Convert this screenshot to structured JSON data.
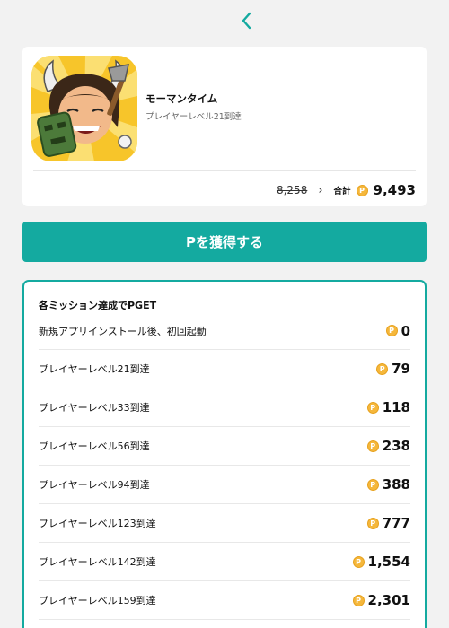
{
  "header": {
    "back_icon": "chevron-left-icon",
    "accent": "#14aaa0"
  },
  "app": {
    "name": "モーマンタイム",
    "subtitle": "プレイヤーレベル21到達",
    "old_points": "8,258",
    "total_label": "合計",
    "total_points": "9,493",
    "coin_symbol": "P"
  },
  "cta": {
    "label": "Pを獲得する"
  },
  "missions": {
    "title": "各ミッション達成でPGET",
    "items": [
      {
        "label": "新規アプリインストール後、初回起動",
        "reward": "0"
      },
      {
        "label": "プレイヤーレベル21到達",
        "reward": "79"
      },
      {
        "label": "プレイヤーレベル33到達",
        "reward": "118"
      },
      {
        "label": "プレイヤーレベル56到達",
        "reward": "238"
      },
      {
        "label": "プレイヤーレベル94到達",
        "reward": "388"
      },
      {
        "label": "プレイヤーレベル123到達",
        "reward": "777"
      },
      {
        "label": "プレイヤーレベル142到達",
        "reward": "1,554"
      },
      {
        "label": "プレイヤーレベル159到達",
        "reward": "2,301"
      }
    ]
  }
}
